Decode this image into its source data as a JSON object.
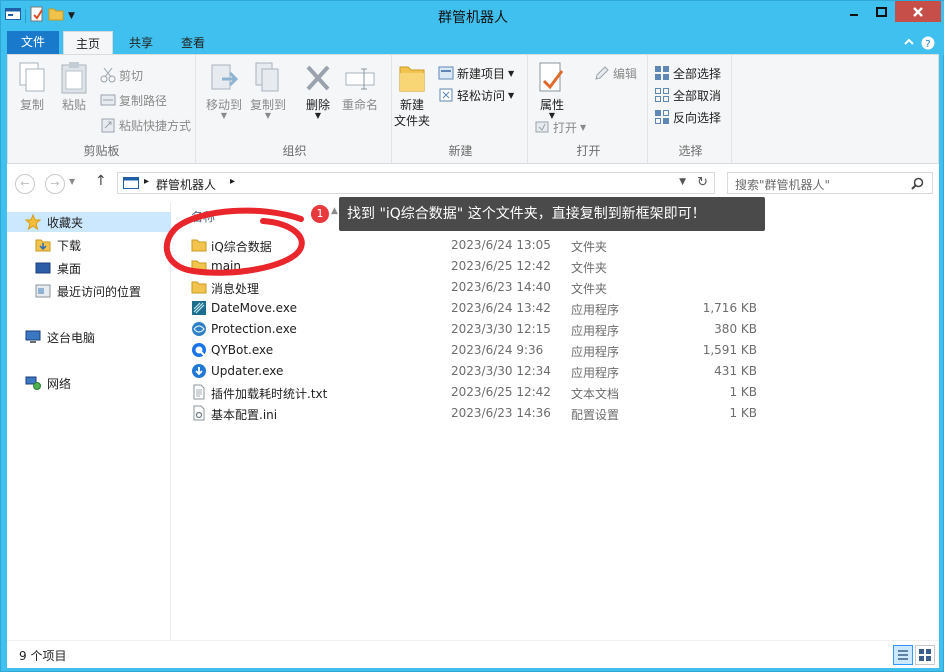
{
  "window": {
    "title": "群管机器人"
  },
  "tabs": {
    "file": "文件",
    "home": "主页",
    "share": "共享",
    "view": "查看"
  },
  "ribbon": {
    "clipboard": {
      "label": "剪贴板",
      "copy": "复制",
      "paste": "粘贴",
      "cut": "剪切",
      "copy_path": "复制路径",
      "paste_shortcut": "粘贴快捷方式"
    },
    "organize": {
      "label": "组织",
      "move_to": "移动到",
      "copy_to": "复制到",
      "delete": "删除",
      "rename": "重命名"
    },
    "new": {
      "label": "新建",
      "new_folder_line1": "新建",
      "new_folder_line2": "文件夹",
      "new_item": "新建项目",
      "easy_access": "轻松访问"
    },
    "open": {
      "label": "打开",
      "properties": "属性",
      "open": "打开",
      "edit": "编辑"
    },
    "select": {
      "label": "选择",
      "select_all": "全部选择",
      "select_none": "全部取消",
      "invert": "反向选择"
    }
  },
  "address": {
    "crumb": "群管机器人",
    "search_placeholder": "搜索\"群管机器人\""
  },
  "navpane": {
    "favorites": "收藏夹",
    "downloads": "下载",
    "desktop": "桌面",
    "recent": "最近访问的位置",
    "this_pc": "这台电脑",
    "network": "网络"
  },
  "files": {
    "col_name": "名称",
    "rows": [
      {
        "name": "iQ综合数据",
        "date": "2023/6/24 13:05",
        "type": "文件夹",
        "size": ""
      },
      {
        "name": "main",
        "date": "2023/6/25 12:42",
        "type": "文件夹",
        "size": ""
      },
      {
        "name": "消息处理",
        "date": "2023/6/23 14:40",
        "type": "文件夹",
        "size": ""
      },
      {
        "name": "DateMove.exe",
        "date": "2023/6/24 13:42",
        "type": "应用程序",
        "size": "1,716 KB"
      },
      {
        "name": "Protection.exe",
        "date": "2023/3/30 12:15",
        "type": "应用程序",
        "size": "380 KB"
      },
      {
        "name": "QYBot.exe",
        "date": "2023/6/24 9:36",
        "type": "应用程序",
        "size": "1,591 KB"
      },
      {
        "name": "Updater.exe",
        "date": "2023/3/30 12:34",
        "type": "应用程序",
        "size": "431 KB"
      },
      {
        "name": "插件加载耗时统计.txt",
        "date": "2023/6/25 12:42",
        "type": "文本文档",
        "size": "1 KB"
      },
      {
        "name": "基本配置.ini",
        "date": "2023/6/23 14:36",
        "type": "配置设置",
        "size": "1 KB"
      }
    ]
  },
  "tooltip": {
    "badge": "1",
    "text": "找到 \"iQ综合数据\" 这个文件夹，直接复制到新框架即可！"
  },
  "status": {
    "count": "9 个项目"
  },
  "colors": {
    "accent": "#3fc0ee",
    "file_tab": "#1979ca",
    "close": "#c74f4a",
    "annotation": "#e8262c"
  }
}
